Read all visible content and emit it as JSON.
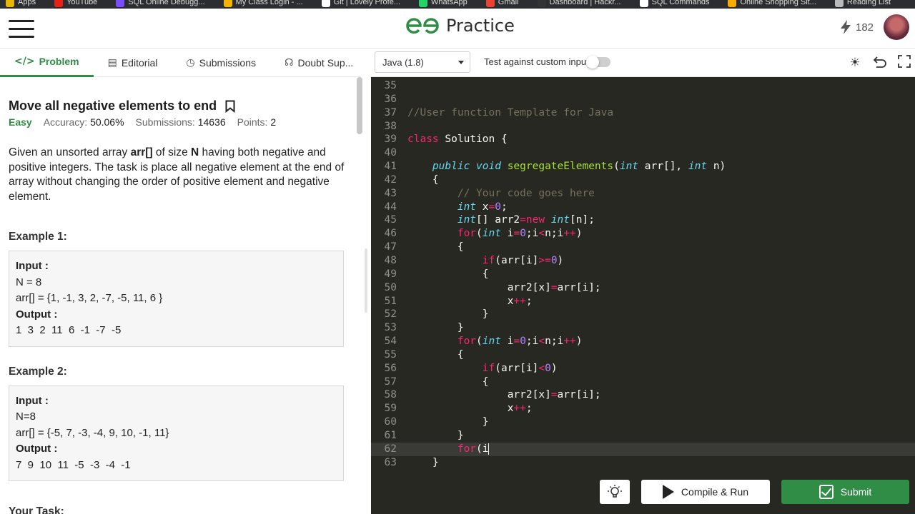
{
  "bookmarks": [
    "Apps",
    "YouTube",
    "SQL Online Debugg...",
    "My Class Login - ...",
    "Git | Lovely Profe...",
    "WhatsApp",
    "Gmail",
    "Dashboard | Hackr...",
    "SQL Commands",
    "Online Shopping Sit...",
    "Reading List"
  ],
  "header": {
    "logo_text": "Practice",
    "streak": "182"
  },
  "tabs": [
    {
      "icon": "</>",
      "label": "Problem"
    },
    {
      "icon": "▤",
      "label": "Editorial"
    },
    {
      "icon": "◷",
      "label": "Submissions"
    },
    {
      "icon": "☊",
      "label": "Doubt Sup..."
    }
  ],
  "problem": {
    "title": "Move all negative elements to end",
    "difficulty": "Easy",
    "accuracy_label": "Accuracy:",
    "accuracy": "50.06%",
    "submissions_label": "Submissions:",
    "submissions": "14636",
    "points_label": "Points:",
    "points": "2",
    "desc_1": "Given an unsorted array ",
    "desc_arr": "arr[]",
    "desc_2": " of size ",
    "desc_n": "N",
    "desc_3": " having both negative and positive integers. The task is place all negative element at the end of array without changing the order of positive element and negative element.",
    "example1": {
      "heading": "Example 1:",
      "input_label": "Input :",
      "n": "N = 8",
      "arr": "arr[] = {1, -1, 3, 2, -7, -5, 11, 6 }",
      "output_label": "Output :",
      "output": "1  3  2  11  6  -1  -7  -5"
    },
    "example2": {
      "heading": "Example 2:",
      "input_label": "Input :",
      "n": "N=8",
      "arr": "arr[] = {-5, 7, -3, -4, 9, 10, -1, 11}",
      "output_label": "Output :",
      "output": "7  9  10  11  -5  -3  -4  -1"
    },
    "your_task": "Your Task:"
  },
  "toolbar": {
    "language": "Java (1.8)",
    "custom_input_label": "Test against custom input",
    "custom_input_enabled": false
  },
  "editor": {
    "current_line": 62,
    "lines": [
      {
        "n": "35"
      },
      {
        "n": "36"
      },
      {
        "n": "37"
      },
      {
        "n": "38"
      },
      {
        "n": "39"
      },
      {
        "n": "40"
      },
      {
        "n": "41"
      },
      {
        "n": "42"
      },
      {
        "n": "43"
      },
      {
        "n": "44"
      },
      {
        "n": "45"
      },
      {
        "n": "46"
      },
      {
        "n": "47"
      },
      {
        "n": "48"
      },
      {
        "n": "49"
      },
      {
        "n": "50"
      },
      {
        "n": "51"
      },
      {
        "n": "52"
      },
      {
        "n": "53"
      },
      {
        "n": "54"
      },
      {
        "n": "55"
      },
      {
        "n": "56"
      },
      {
        "n": "57"
      },
      {
        "n": "58"
      },
      {
        "n": "59"
      },
      {
        "n": "60"
      },
      {
        "n": "61"
      },
      {
        "n": "62"
      },
      {
        "n": "63"
      }
    ],
    "code": {
      "c37": "//User function Template for Java",
      "c39_kw": "class",
      "c39_rest": " Solution {",
      "c41_kw": "public",
      "c41_ty": "void",
      "c41_fn": "segregateElements",
      "c41_p1": "(",
      "c41_ty2": "int",
      "c41_p2": " arr[], ",
      "c41_ty3": "int",
      "c41_p3": " n)",
      "brace_open": "{",
      "brace_close": "}",
      "c43": "// Your code goes here",
      "c44_ty": "int",
      "c44_a": " x",
      "c44_op": "=",
      "c44_num": "0",
      "c44_end": ";",
      "c45_ty": "int",
      "c45_a": "[] arr2",
      "c45_op": "=",
      "c45_kw": "new",
      "c45_ty2": " int",
      "c45_b": "[n];",
      "for_kw": "for",
      "for_a": "(",
      "for_ty": "int",
      "for_b": " i",
      "for_op1": "=",
      "for_num": "0",
      "for_c": ";i",
      "for_op2": "<",
      "for_d": "n;i",
      "for_op3": "++",
      "for_e": ")",
      "if_kw": "if",
      "if_a": "(arr[i]",
      "if1_op": ">=",
      "if2_op": "<",
      "if_num": "0",
      "if_e": ")",
      "assign_a": "arr2[x]",
      "assign_op": "=",
      "assign_b": "arr[i];",
      "inc_a": "x",
      "inc_op": "++",
      "inc_b": ";",
      "c62_kw": "for",
      "c62_rest": "(i"
    }
  },
  "bottom": {
    "run_label": "Compile & Run",
    "submit_label": "Submit"
  }
}
